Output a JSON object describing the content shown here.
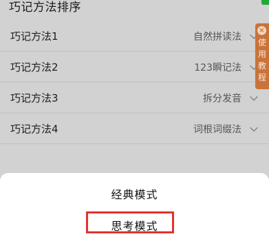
{
  "header": {
    "title": "巧记方法排序"
  },
  "rows": [
    {
      "label": "巧记方法1",
      "value": "自然拼读法"
    },
    {
      "label": "巧记方法2",
      "value": "123瞬记法"
    },
    {
      "label": "巧记方法3",
      "value": "拆分发音"
    },
    {
      "label": "巧记方法4",
      "value": "词根词缀法"
    }
  ],
  "tutorial": {
    "close": "×",
    "text": "使用教程"
  },
  "sheet": {
    "options": [
      "经典模式",
      "思考模式"
    ]
  },
  "colors": {
    "background": "#d2d2d2",
    "tutorial_tab": "#c9733a",
    "highlight": "#e3322c",
    "header_button": "#1faa3a"
  }
}
